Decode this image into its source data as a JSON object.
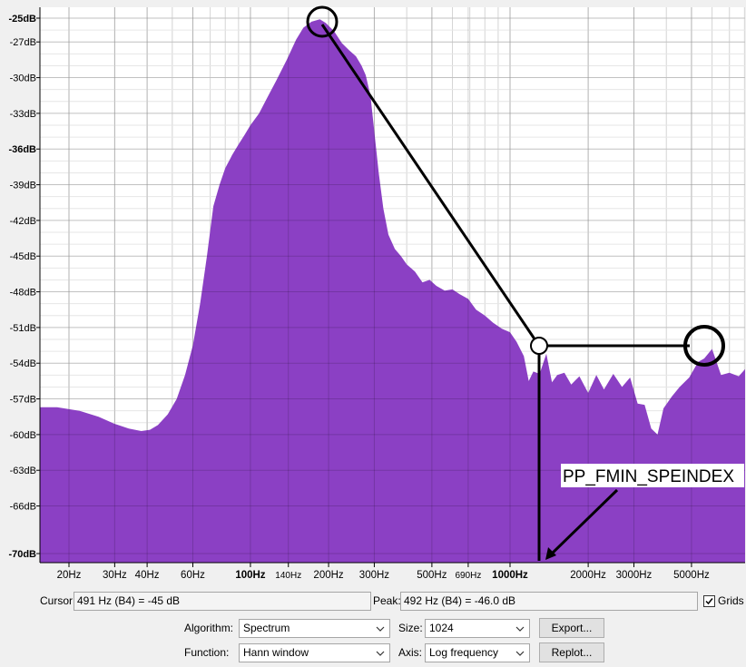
{
  "chart_data": {
    "type": "area",
    "xscale": "log",
    "ylim": [
      -70,
      -25
    ],
    "xlim": [
      14,
      12000
    ],
    "grid": true,
    "fill_color": "#8b40c4",
    "y_ticks": [
      {
        "label": "-25dB",
        "value": -25,
        "bold": true
      },
      {
        "label": "-27dB",
        "value": -27
      },
      {
        "label": "-30dB",
        "value": -30
      },
      {
        "label": "-33dB",
        "value": -33
      },
      {
        "label": "-36dB",
        "value": -36,
        "bold": true
      },
      {
        "label": "-39dB",
        "value": -39
      },
      {
        "label": "-42dB",
        "value": -42
      },
      {
        "label": "-45dB",
        "value": -45
      },
      {
        "label": "-48dB",
        "value": -48
      },
      {
        "label": "-51dB",
        "value": -51
      },
      {
        "label": "-54dB",
        "value": -54
      },
      {
        "label": "-57dB",
        "value": -57
      },
      {
        "label": "-60dB",
        "value": -60
      },
      {
        "label": "-63dB",
        "value": -63
      },
      {
        "label": "-66dB",
        "value": -66
      },
      {
        "label": "-70dB",
        "value": -70,
        "bold": true
      }
    ],
    "x_ticks": [
      {
        "label": "20Hz",
        "value": 20
      },
      {
        "label": "30Hz",
        "value": 30
      },
      {
        "label": "40Hz",
        "value": 40
      },
      {
        "label": "60Hz",
        "value": 60
      },
      {
        "label": "100Hz",
        "value": 100,
        "bold": true
      },
      {
        "label": "140Hz",
        "value": 140,
        "small": true
      },
      {
        "label": "200Hz",
        "value": 200
      },
      {
        "label": "300Hz",
        "value": 300
      },
      {
        "label": "500Hz",
        "value": 500
      },
      {
        "label": "690Hz",
        "value": 690,
        "small": true
      },
      {
        "label": "1000Hz",
        "value": 1000,
        "bold": true
      },
      {
        "label": "2000Hz",
        "value": 2000
      },
      {
        "label": "3000Hz",
        "value": 3000
      },
      {
        "label": "5000Hz",
        "value": 5000
      }
    ],
    "series": [
      {
        "values": [
          [
            14,
            -57.7
          ],
          [
            18,
            -57.7
          ],
          [
            22,
            -58.0
          ],
          [
            26,
            -58.5
          ],
          [
            30,
            -59.1
          ],
          [
            34,
            -59.5
          ],
          [
            38,
            -59.7
          ],
          [
            41,
            -59.6
          ],
          [
            44,
            -59.2
          ],
          [
            48,
            -58.3
          ],
          [
            52,
            -57.0
          ],
          [
            56,
            -55.0
          ],
          [
            60,
            -52.5
          ],
          [
            64,
            -49.0
          ],
          [
            68,
            -45.0
          ],
          [
            72,
            -40.8
          ],
          [
            76,
            -39.0
          ],
          [
            80,
            -37.6
          ],
          [
            85,
            -36.5
          ],
          [
            90,
            -35.6
          ],
          [
            95,
            -34.8
          ],
          [
            100,
            -34.0
          ],
          [
            108,
            -33.0
          ],
          [
            116,
            -31.7
          ],
          [
            126,
            -30.2
          ],
          [
            138,
            -28.5
          ],
          [
            150,
            -26.8
          ],
          [
            160,
            -25.8
          ],
          [
            172,
            -25.3
          ],
          [
            185,
            -25.1
          ],
          [
            195,
            -25.4
          ],
          [
            210,
            -26.1
          ],
          [
            225,
            -27.1
          ],
          [
            240,
            -27.7
          ],
          [
            255,
            -28.2
          ],
          [
            268,
            -29.0
          ],
          [
            278,
            -29.8
          ],
          [
            290,
            -31.5
          ],
          [
            300,
            -34.5
          ],
          [
            312,
            -38.0
          ],
          [
            325,
            -41.0
          ],
          [
            340,
            -43.2
          ],
          [
            360,
            -44.4
          ],
          [
            380,
            -45.0
          ],
          [
            400,
            -45.7
          ],
          [
            430,
            -46.3
          ],
          [
            460,
            -47.2
          ],
          [
            490,
            -47.0
          ],
          [
            520,
            -47.5
          ],
          [
            560,
            -47.9
          ],
          [
            600,
            -47.8
          ],
          [
            640,
            -48.2
          ],
          [
            690,
            -48.6
          ],
          [
            740,
            -49.5
          ],
          [
            800,
            -50.0
          ],
          [
            860,
            -50.6
          ],
          [
            930,
            -51.1
          ],
          [
            1000,
            -51.4
          ],
          [
            1060,
            -52.2
          ],
          [
            1130,
            -53.4
          ],
          [
            1180,
            -55.5
          ],
          [
            1230,
            -54.7
          ],
          [
            1300,
            -54.9
          ],
          [
            1380,
            -53.2
          ],
          [
            1450,
            -55.6
          ],
          [
            1520,
            -55.0
          ],
          [
            1620,
            -54.8
          ],
          [
            1720,
            -55.8
          ],
          [
            1850,
            -55.1
          ],
          [
            2000,
            -56.5
          ],
          [
            2150,
            -55.0
          ],
          [
            2300,
            -56.2
          ],
          [
            2500,
            -54.9
          ],
          [
            2700,
            -56.0
          ],
          [
            2900,
            -55.2
          ],
          [
            3100,
            -57.4
          ],
          [
            3300,
            -57.5
          ],
          [
            3500,
            -59.5
          ],
          [
            3700,
            -60.0
          ],
          [
            3900,
            -57.8
          ],
          [
            4200,
            -56.8
          ],
          [
            4500,
            -56.0
          ],
          [
            4900,
            -55.2
          ],
          [
            5300,
            -53.9
          ],
          [
            5600,
            -53.6
          ],
          [
            6000,
            -52.8
          ],
          [
            6500,
            -55.0
          ],
          [
            7000,
            -54.8
          ],
          [
            7600,
            -55.1
          ],
          [
            8300,
            -54.5
          ],
          [
            9000,
            -55.6
          ],
          [
            10000,
            -54.3
          ],
          [
            11000,
            -53.5
          ],
          [
            12000,
            -53.2
          ]
        ]
      }
    ],
    "annotations": [
      {
        "text": "PP_FMIN_SPEINDEX"
      }
    ]
  },
  "controls": {
    "cursor_label": "Cursor:",
    "cursor_value": "491 Hz (B4) = -45 dB",
    "peak_label": "Peak:",
    "peak_value": "492 Hz (B4) = -46.0 dB",
    "grids_label": "Grids",
    "grids_checked": true,
    "algorithm_label": "Algorithm:",
    "algorithm_value": "Spectrum",
    "size_label": "Size:",
    "size_value": "1024",
    "export_label": "Export...",
    "function_label": "Function:",
    "function_value": "Hann window",
    "axis_label": "Axis:",
    "axis_value": "Log frequency",
    "replot_label": "Replot..."
  }
}
